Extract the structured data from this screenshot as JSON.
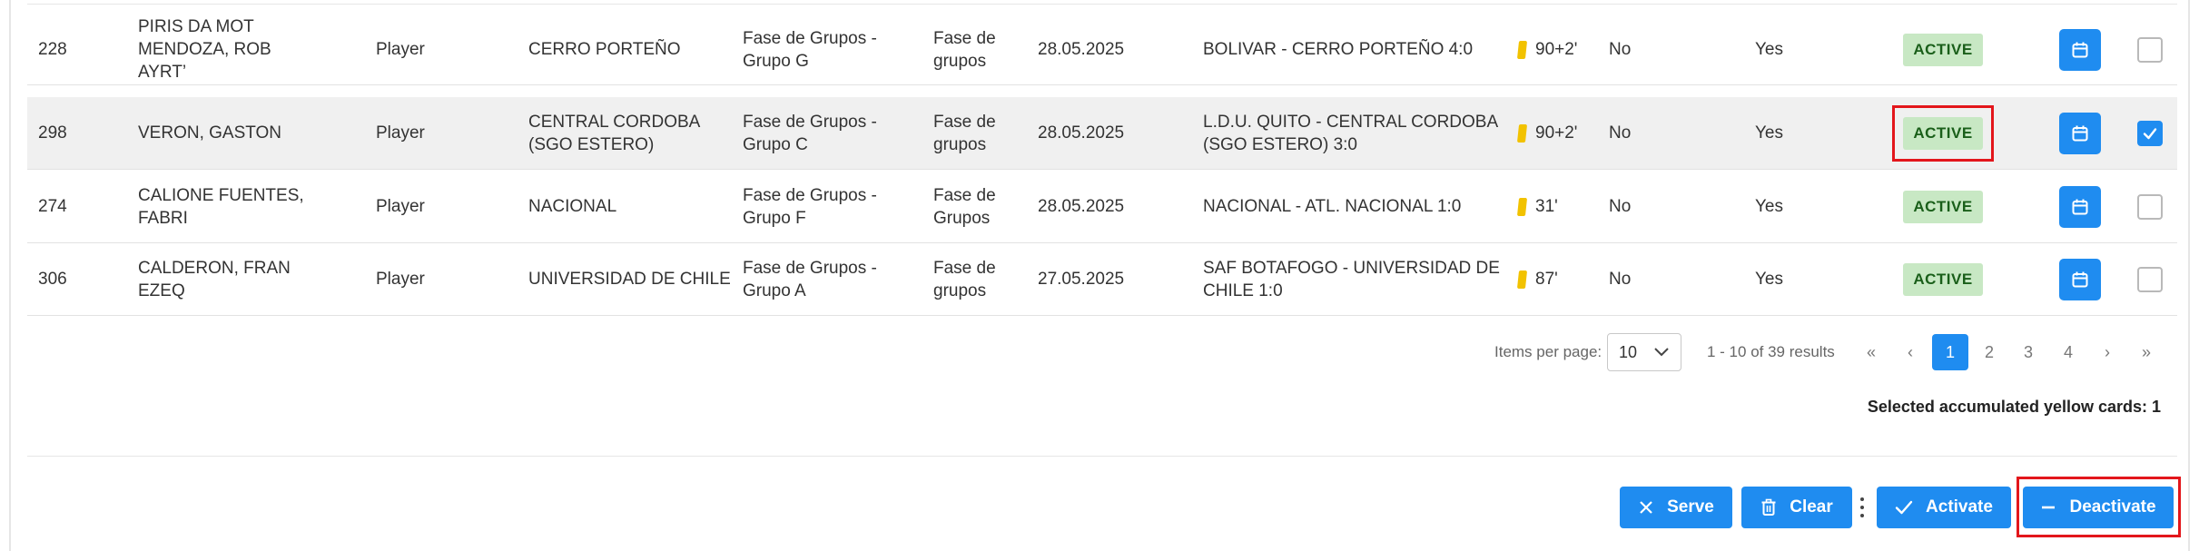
{
  "rows": [
    {
      "num": "228",
      "name_lines": [
        "PIRIS DA MOT",
        "MENDOZA, ROB",
        "AYRT’"
      ],
      "role": "Player",
      "team_lines": [
        "CERRO PORTEÑO",
        ""
      ],
      "phase_lines": [
        "Fase de Grupos -",
        "Grupo G"
      ],
      "round_lines": [
        "Fase de",
        "grupos"
      ],
      "date": "28.05.2025",
      "match_lines": [
        "BOLIVAR - CERRO PORTEÑO 4:0",
        ""
      ],
      "card_minute": "90+2'",
      "col1": "No",
      "col2": "Yes",
      "status": "ACTIVE",
      "checked": false
    },
    {
      "num": "298",
      "name_lines": [
        "VERON, GASTON"
      ],
      "role": "Player",
      "team_lines": [
        "CENTRAL CORDOBA",
        "(SGO ESTERO)"
      ],
      "phase_lines": [
        "Fase de Grupos -",
        "Grupo C"
      ],
      "round_lines": [
        "Fase de",
        "grupos"
      ],
      "date": "28.05.2025",
      "match_lines": [
        "L.D.U. QUITO - CENTRAL CORDOBA",
        "(SGO ESTERO) 3:0"
      ],
      "card_minute": "90+2'",
      "col1": "No",
      "col2": "Yes",
      "status": "ACTIVE",
      "checked": true
    },
    {
      "num": "274",
      "name_lines": [
        "CALIONE FUENTES,",
        "FABRI"
      ],
      "role": "Player",
      "team_lines": [
        "NACIONAL",
        ""
      ],
      "phase_lines": [
        "Fase de Grupos -",
        "Grupo F"
      ],
      "round_lines": [
        "Fase de",
        "Grupos"
      ],
      "date": "28.05.2025",
      "match_lines": [
        "NACIONAL - ATL. NACIONAL 1:0",
        ""
      ],
      "card_minute": "31'",
      "col1": "No",
      "col2": "Yes",
      "status": "ACTIVE",
      "checked": false
    },
    {
      "num": "306",
      "name_lines": [
        "CALDERON, FRAN",
        "EZEQ"
      ],
      "role": "Player",
      "team_lines": [
        "UNIVERSIDAD DE CHILE",
        ""
      ],
      "phase_lines": [
        "Fase de Grupos -",
        "Grupo A"
      ],
      "round_lines": [
        "Fase de",
        "grupos"
      ],
      "date": "27.05.2025",
      "match_lines": [
        "SAF BOTAFOGO - UNIVERSIDAD DE",
        "CHILE 1:0"
      ],
      "card_minute": "87'",
      "col1": "No",
      "col2": "Yes",
      "status": "ACTIVE",
      "checked": false
    }
  ],
  "pagination": {
    "items_per_page_label": "Items per page:",
    "items_per_page_value": "10",
    "range_text": "1 - 10 of 39 results",
    "first": "«",
    "prev": "‹",
    "pages": [
      "1",
      "2",
      "3",
      "4"
    ],
    "current_page": "1",
    "next": "›",
    "last": "»"
  },
  "summary": {
    "text": "Selected accumulated yellow cards: 1"
  },
  "actions": {
    "serve": "Serve",
    "clear": "Clear",
    "activate": "Activate",
    "deactivate": "Deactivate"
  },
  "colors": {
    "primary": "#1f8cf0",
    "active_badge_bg": "#c8e8c4",
    "active_badge_text": "#1a5f1a",
    "yellow_card": "#f2c200",
    "highlight": "#e3161b"
  },
  "icons": {
    "calendar": "calendar-icon",
    "checkbox": "checkmark-icon",
    "serve": "close-x-icon",
    "clear": "trash-icon",
    "activate": "checkmark-icon",
    "deactivate": "minus-icon",
    "more": "kebab-menu-icon",
    "dropdown": "chevron-down-icon"
  }
}
